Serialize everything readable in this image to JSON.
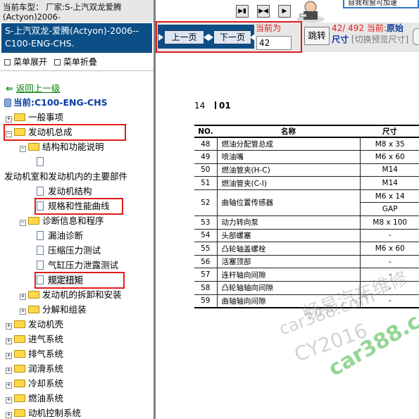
{
  "left": {
    "current_model_text": "当前车型： 厂家:S-上汽双龙爱腾(Actyon)2006-",
    "model_title": "S-上汽双龙-爱腾(Actyon)-2006--C100-ENG-CHS.",
    "expand_label": "菜单展开",
    "collapse_label": "菜单折叠",
    "back_label": "返回上一级",
    "current_node": "当前:C100-ENG-CHS",
    "tree": [
      {
        "label": "一般事项",
        "level": 0,
        "kind": "folder",
        "pm": "+"
      },
      {
        "label": "发动机总成",
        "level": 0,
        "kind": "folder",
        "pm": "-",
        "boxed": true
      },
      {
        "label": "结构和功能说明",
        "level": 1,
        "kind": "folder",
        "pm": "-"
      },
      {
        "label": "",
        "level": 2,
        "kind": "doc"
      },
      {
        "label": "发动机室和发动机内的主要部件",
        "level": -1,
        "kind": "text"
      },
      {
        "label": "发动机结构",
        "level": 2,
        "kind": "doc"
      },
      {
        "label": "规格和性能曲线",
        "level": 2,
        "kind": "doc",
        "boxed": true
      },
      {
        "label": "诊断信息和程序",
        "level": 1,
        "kind": "folder",
        "pm": "-"
      },
      {
        "label": "漏油诊断",
        "level": 2,
        "kind": "doc"
      },
      {
        "label": "压缩压力测试",
        "level": 2,
        "kind": "doc"
      },
      {
        "label": "气缸压力泄露测试",
        "level": 2,
        "kind": "doc"
      },
      {
        "label": "规定扭矩",
        "level": 2,
        "kind": "doc",
        "boxed": true,
        "selected": true
      },
      {
        "label": "发动机的拆卸和安装",
        "level": 1,
        "kind": "folder",
        "pm": "+"
      },
      {
        "label": "分解和组装",
        "level": 1,
        "kind": "folder",
        "pm": "+"
      },
      {
        "label": "发动机壳",
        "level": 0,
        "kind": "folder",
        "pm": "+"
      },
      {
        "label": "进气系统",
        "level": 0,
        "kind": "folder",
        "pm": "+"
      },
      {
        "label": "排气系统",
        "level": 0,
        "kind": "folder",
        "pm": "+"
      },
      {
        "label": "润滑系统",
        "level": 0,
        "kind": "folder",
        "pm": "+"
      },
      {
        "label": "冷却系统",
        "level": 0,
        "kind": "folder",
        "pm": "+"
      },
      {
        "label": "燃油系统",
        "level": 0,
        "kind": "folder",
        "pm": "+"
      },
      {
        "label": "动机控制系统",
        "level": 0,
        "kind": "folder",
        "pm": "+"
      }
    ]
  },
  "toolbar": {
    "prev_label": "上一页",
    "next_label": "下一页",
    "current_label": "当前为",
    "page_value": "42",
    "jump_label": "跳转",
    "page_count": "42/ 492",
    "current_prefix": "当前:",
    "original_label": "原始",
    "size_label": "尺寸",
    "switch_label": "[切换预览尺寸]",
    "banner_text": "自我视窗可加速"
  },
  "document": {
    "page_number": "14",
    "section": "01",
    "columns": [
      "NO.",
      "名称",
      "尺寸"
    ],
    "rows": [
      {
        "no": "48",
        "name": "燃油分配管总成",
        "size": "M8 x 35"
      },
      {
        "no": "49",
        "name": "喷油嘴",
        "size": "M6 x 60"
      },
      {
        "no": "50",
        "name": "燃油管夹(H-C)",
        "size": "M14"
      },
      {
        "no": "51",
        "name": "燃油管夹(C-I)",
        "size": "M14"
      },
      {
        "no": "52",
        "name": "曲轴位置传感器",
        "size": "M6 x 14",
        "size2": "GAP"
      },
      {
        "no": "53",
        "name": "动力转向泵",
        "size": "M8 x 100"
      },
      {
        "no": "54",
        "name": "头部螺塞",
        "size": "-"
      },
      {
        "no": "55",
        "name": "凸轮轴盖螺栓",
        "size": "M6 x 60"
      },
      {
        "no": "56",
        "name": "活塞顶部",
        "size": "-"
      },
      {
        "no": "57",
        "name": "连杆轴向间隙",
        "size": "-"
      },
      {
        "no": "58",
        "name": "凸轮轴轴向间隙",
        "size": "-"
      },
      {
        "no": "59",
        "name": "曲轴轴向间隙",
        "size": "-"
      }
    ],
    "watermarks": [
      "畅易汽车维修",
      "car388.com",
      "CY2016",
      "car388.com"
    ]
  }
}
